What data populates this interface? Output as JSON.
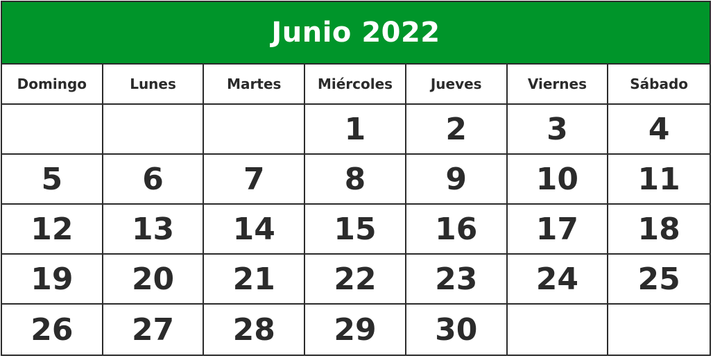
{
  "calendar": {
    "title": "Junio 2022",
    "header_color": "#00952A",
    "weekdays": [
      "Domingo",
      "Lunes",
      "Martes",
      "Miércoles",
      "Jueves",
      "Viernes",
      "Sábado"
    ],
    "weeks": [
      [
        "",
        "",
        "",
        "1",
        "2",
        "3",
        "4"
      ],
      [
        "5",
        "6",
        "7",
        "8",
        "9",
        "10",
        "11"
      ],
      [
        "12",
        "13",
        "14",
        "15",
        "16",
        "17",
        "18"
      ],
      [
        "19",
        "20",
        "21",
        "22",
        "23",
        "24",
        "25"
      ],
      [
        "26",
        "27",
        "28",
        "29",
        "30",
        "",
        ""
      ]
    ]
  }
}
